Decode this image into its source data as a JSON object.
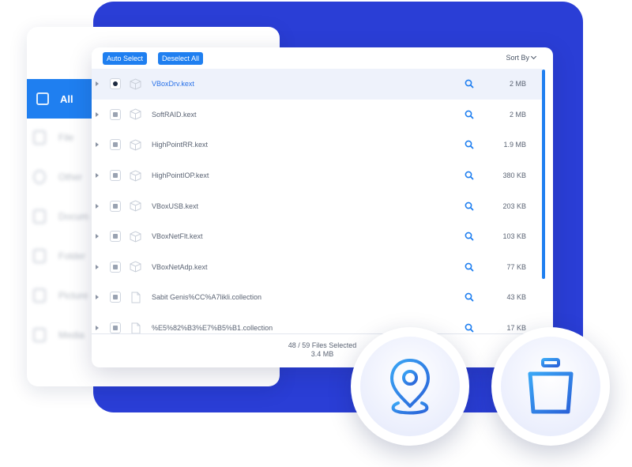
{
  "sidebar": {
    "active_label": "All",
    "items": [
      {
        "label": "File",
        "icon": "file-icon"
      },
      {
        "label": "Other",
        "icon": "other-icon"
      },
      {
        "label": "Docum",
        "icon": "document-icon"
      },
      {
        "label": "Folder",
        "icon": "folder-icon"
      },
      {
        "label": "Picture",
        "icon": "picture-icon"
      },
      {
        "label": "Media",
        "icon": "media-icon"
      }
    ]
  },
  "toolbar": {
    "auto_select_label": "Auto Select",
    "deselect_all_label": "Deselect All",
    "sort_by_label": "Sort By"
  },
  "files": [
    {
      "name": "VBoxDrv.kext",
      "size": "2 MB",
      "selected": true,
      "type": "kext"
    },
    {
      "name": "SoftRAID.kext",
      "size": "2 MB",
      "selected": false,
      "type": "kext"
    },
    {
      "name": "HighPointRR.kext",
      "size": "1.9 MB",
      "selected": false,
      "type": "kext"
    },
    {
      "name": "HighPointIOP.kext",
      "size": "380 KB",
      "selected": false,
      "type": "kext"
    },
    {
      "name": "VBoxUSB.kext",
      "size": "203 KB",
      "selected": false,
      "type": "kext"
    },
    {
      "name": "VBoxNetFlt.kext",
      "size": "103 KB",
      "selected": false,
      "type": "kext"
    },
    {
      "name": "VBoxNetAdp.kext",
      "size": "77 KB",
      "selected": false,
      "type": "kext"
    },
    {
      "name": "Sabit Genis%CC%A7likli.collection",
      "size": "43 KB",
      "selected": false,
      "type": "collection"
    },
    {
      "name": "%E5%82%B3%E7%B5%B1.collection",
      "size": "17 KB",
      "selected": false,
      "type": "collection"
    }
  ],
  "footer": {
    "selection_text": "48 / 59 Files Selected",
    "total_size": "3.4 MB"
  },
  "actions": {
    "locate_icon": "location-pin-icon",
    "delete_icon": "trash-icon"
  },
  "colors": {
    "brand_blue": "#2a3ed6",
    "accent_blue": "#1f7ff0"
  }
}
